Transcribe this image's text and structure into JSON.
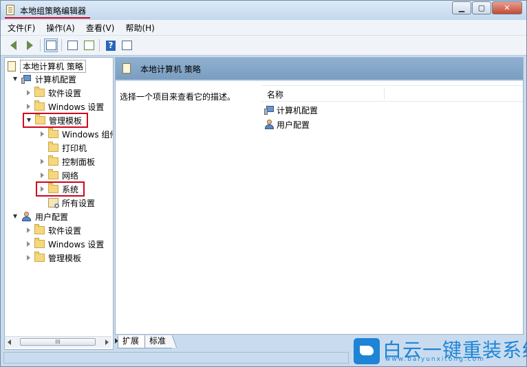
{
  "window": {
    "title": "本地组策略编辑器",
    "minimize_glyph": "▁",
    "maximize_glyph": "▢",
    "close_glyph": "✕"
  },
  "menu": [
    "文件(F)",
    "操作(A)",
    "查看(V)",
    "帮助(H)"
  ],
  "toolbar": {
    "icons": [
      "back-arrow-icon",
      "forward-arrow-icon",
      "show-hide-tree-icon",
      "properties-icon",
      "export-list-icon",
      "help-icon",
      "show-filter-icon"
    ],
    "help_glyph": "?"
  },
  "tree": {
    "root": "本地计算机 策略",
    "computer_config": "计算机配置",
    "cc_software": "软件设置",
    "cc_windows": "Windows 设置",
    "cc_admin": "管理模板",
    "admin_windows": "Windows 组件",
    "admin_printer": "打印机",
    "admin_control": "控制面板",
    "admin_network": "网络",
    "admin_system": "系统",
    "admin_all": "所有设置",
    "user_config": "用户配置",
    "uc_software": "软件设置",
    "uc_windows": "Windows 设置",
    "uc_admin": "管理模板"
  },
  "scrollbar": {
    "grip": "III"
  },
  "right_pane": {
    "header_title": "本地计算机 策略",
    "description": "选择一个项目来查看它的描述。",
    "column_name": "名称",
    "items": [
      "计算机配置",
      "用户配置"
    ]
  },
  "tabs": [
    "扩展",
    "标准"
  ],
  "watermark": {
    "main": "白云一键重装系统",
    "sub": "www.baiyunxitong.com"
  },
  "colors": {
    "accent_blue": "#1e84d6",
    "highlight_red": "#d0021b",
    "header_blue": "#8fb0d0"
  }
}
